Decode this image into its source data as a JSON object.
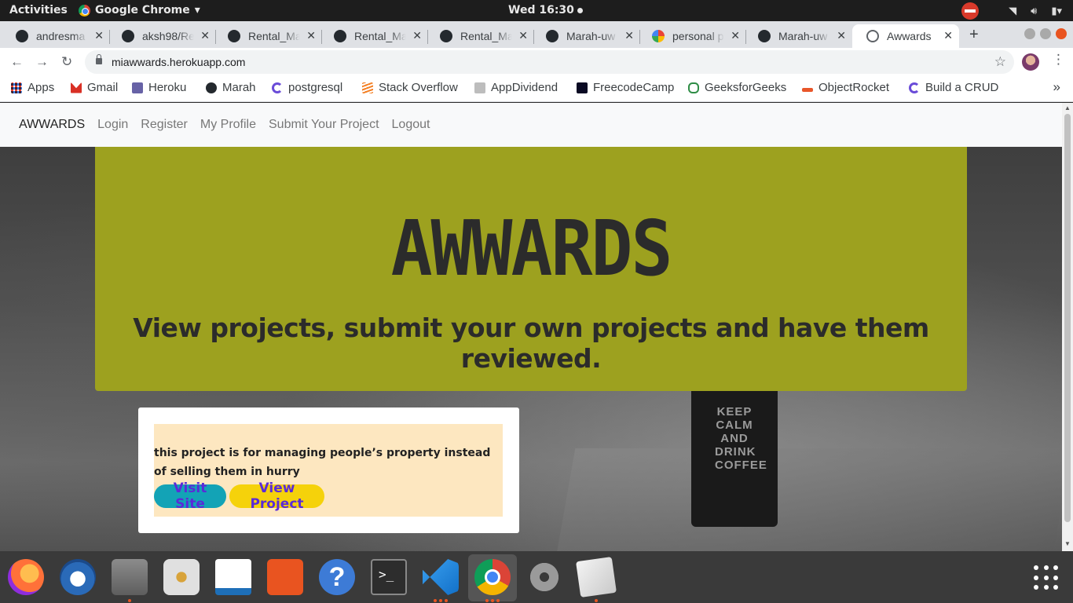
{
  "system_bar": {
    "activities": "Activities",
    "app_name": "Google Chrome",
    "clock": "Wed 16:30"
  },
  "tabs": [
    {
      "label": "andresma",
      "icon": "github-icon"
    },
    {
      "label": "aksh98/Re",
      "icon": "github-icon"
    },
    {
      "label": "Rental_Ma",
      "icon": "github-icon"
    },
    {
      "label": "Rental_Ma",
      "icon": "github-icon"
    },
    {
      "label": "Rental_Ma",
      "icon": "github-icon"
    },
    {
      "label": "Marah-uw",
      "icon": "github-icon"
    },
    {
      "label": "personal p",
      "icon": "google-icon"
    },
    {
      "label": "Marah-uw",
      "icon": "github-icon"
    },
    {
      "label": "Awwards",
      "icon": "globe-icon",
      "active": true
    }
  ],
  "address_bar": {
    "url": "miawwards.herokuapp.com"
  },
  "bookmarks": [
    {
      "label": "Apps",
      "icon": "apps-grid-icon"
    },
    {
      "label": "Gmail",
      "icon": "gmail-icon"
    },
    {
      "label": "Heroku",
      "icon": "heroku-icon"
    },
    {
      "label": "Marah",
      "icon": "github-icon"
    },
    {
      "label": "postgresql",
      "icon": "postgresql-icon"
    },
    {
      "label": "Stack Overflow",
      "icon": "stackoverflow-icon"
    },
    {
      "label": "AppDividend",
      "icon": "appdividend-icon"
    },
    {
      "label": "FreecodeCamp",
      "icon": "freecodecamp-icon"
    },
    {
      "label": "GeeksforGeeks",
      "icon": "geeksforgeeks-icon"
    },
    {
      "label": "ObjectRocket",
      "icon": "objectrocket-icon"
    },
    {
      "label": "Build a CRUD",
      "icon": "postgresql-icon"
    }
  ],
  "site_nav": {
    "brand": "AWWARDS",
    "links": [
      "Login",
      "Register",
      "My Profile",
      "Submit Your Project",
      "Logout"
    ]
  },
  "hero": {
    "title": "AWWARDS",
    "subtitle": "View projects, submit your own projects and have them reviewed."
  },
  "project_card": {
    "description": "this project is for managing people’s property instead of selling them in hurry",
    "visit_label": "Visit Site",
    "view_label": "View Project"
  },
  "background": {
    "mug_text": "KEEP CALM AND DRINK COFFEE"
  },
  "colors": {
    "hero_bg": "#9da11f",
    "card_inner_bg": "#fde7c0",
    "visit_btn": "#13a3b6",
    "view_btn": "#f5d20b",
    "btn_text": "#5a2bd8"
  },
  "dock_apps": [
    "firefox-icon",
    "thunderbird-icon",
    "files-icon",
    "rhythmbox-icon",
    "writer-icon",
    "software-center-icon",
    "help-icon",
    "terminal-icon",
    "vscode-icon",
    "chrome-icon",
    "settings-icon",
    "image-viewer-icon"
  ]
}
